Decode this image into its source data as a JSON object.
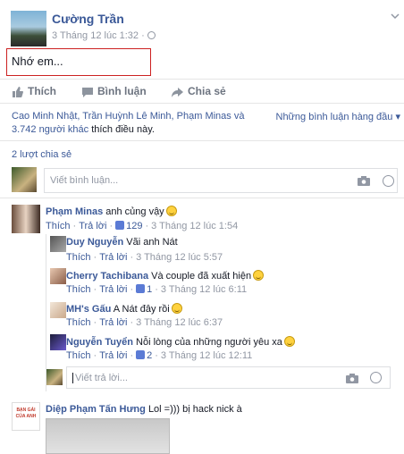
{
  "post": {
    "author": "Cường Trần",
    "timestamp": "3 Tháng 12 lúc 1:32 ·",
    "text": "Nhớ em..."
  },
  "actions": {
    "like": "Thích",
    "comment": "Bình luận",
    "share": "Chia sẻ"
  },
  "likes": {
    "line1": "Cao Minh Nhật, Trần Huỳnh Lê Minh, Phạm Minas và",
    "line2_link": "3.742 người khác",
    "line2_rest": " thích điều này.",
    "top_comments": "Những bình luận hàng đầu ▾"
  },
  "shares": "2 lượt chia sẻ",
  "comment_box": {
    "placeholder": "Viết bình luận..."
  },
  "reply_box": {
    "placeholder": "Viết trả lời..."
  },
  "comments": [
    {
      "name": "Phạm Minas",
      "text": "anh củng vậy",
      "like": "Thích",
      "reply": "Trả lời",
      "likes": "129",
      "time": "3 Tháng 12 lúc 1:54",
      "replies": [
        {
          "name": "Duy Nguyễn",
          "text": "Vãi anh Nát",
          "like": "Thích",
          "reply": "Trả lời",
          "likes": "",
          "time": "3 Tháng 12 lúc 5:57"
        },
        {
          "name": "Cherry Tachibana",
          "text": "Và couple đã xuất hiện",
          "like": "Thích",
          "reply": "Trả lời",
          "likes": "1",
          "time": "3 Tháng 12 lúc 6:11"
        },
        {
          "name": "MH's Gấu",
          "text": "A Nát đây rồi",
          "like": "Thích",
          "reply": "Trả lời",
          "likes": "",
          "time": "3 Tháng 12 lúc 6:37"
        },
        {
          "name": "Nguyễn Tuyển",
          "text": "Nỗi lòng của những người yêu xa",
          "like": "Thích",
          "reply": "Trả lời",
          "likes": "2",
          "time": "3 Tháng 12 lúc 12:11"
        }
      ]
    },
    {
      "name": "Diệp Phạm Tấn Hưng",
      "text": "Lol =))) bị hack nick à",
      "avatar_text": "BẠN GÁI CỦA ANH"
    }
  ],
  "colors": {
    "link": "#3b5998",
    "muted": "#9197a3",
    "highlight": "#cc2121"
  }
}
